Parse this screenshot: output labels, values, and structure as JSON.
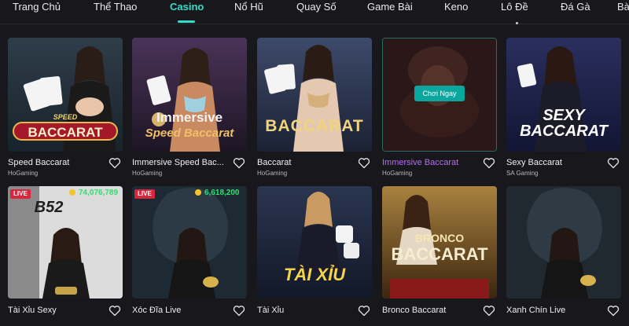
{
  "nav": {
    "items": [
      {
        "label": "Trang Chủ"
      },
      {
        "label": "Thể Thao"
      },
      {
        "label": "Casino",
        "active": true
      },
      {
        "label": "Nổ Hũ"
      },
      {
        "label": "Quay Số"
      },
      {
        "label": "Game Bài"
      },
      {
        "label": "Keno"
      },
      {
        "label": "Lô Đề"
      },
      {
        "label": "Đá Gà"
      },
      {
        "label": "Bà"
      }
    ],
    "active_color": "#2ee0c9"
  },
  "games": [
    {
      "title": "Speed Baccarat",
      "provider": "HoGaming",
      "logo_line1": "SPEED",
      "logo_line2": "BACCARAT"
    },
    {
      "title": "Immersive Speed Bac...",
      "provider": "HoGaming",
      "logo_line1": "Immersive",
      "logo_line2": "Speed Baccarat"
    },
    {
      "title": "Baccarat",
      "provider": "HoGaming",
      "logo_line1": "BACCARAT"
    },
    {
      "title": "Immersive Baccarat",
      "provider": "HoGaming",
      "hovered": true,
      "play_label": "Chơi Ngay"
    },
    {
      "title": "Sexy Baccarat",
      "provider": "SA Gaming",
      "logo_line1": "SEXY",
      "logo_line2": "BACCARAT"
    },
    {
      "title": "Tài Xỉu Sexy",
      "badge": "LIVE",
      "jackpot": "74,076,789",
      "logo_line1": "B52"
    },
    {
      "title": "Xóc Đĩa Live",
      "badge": "LIVE",
      "jackpot": "6,618,200"
    },
    {
      "title": "Tài Xỉu",
      "logo_line1": "TÀI XỈU"
    },
    {
      "title": "Bronco Baccarat",
      "logo_line1": "BRONCO",
      "logo_line2": "BACCARAT"
    },
    {
      "title": "Xanh Chín Live"
    }
  ],
  "colors": {
    "background": "#17171c",
    "title_hover": "#b66cf1",
    "play_button": "#0aa79f",
    "jackpot_text": "#2ee06c",
    "live_badge": "#d9263f"
  },
  "icons": {
    "favorite": "heart-outline-icon",
    "coin": "gold-coin-icon"
  }
}
